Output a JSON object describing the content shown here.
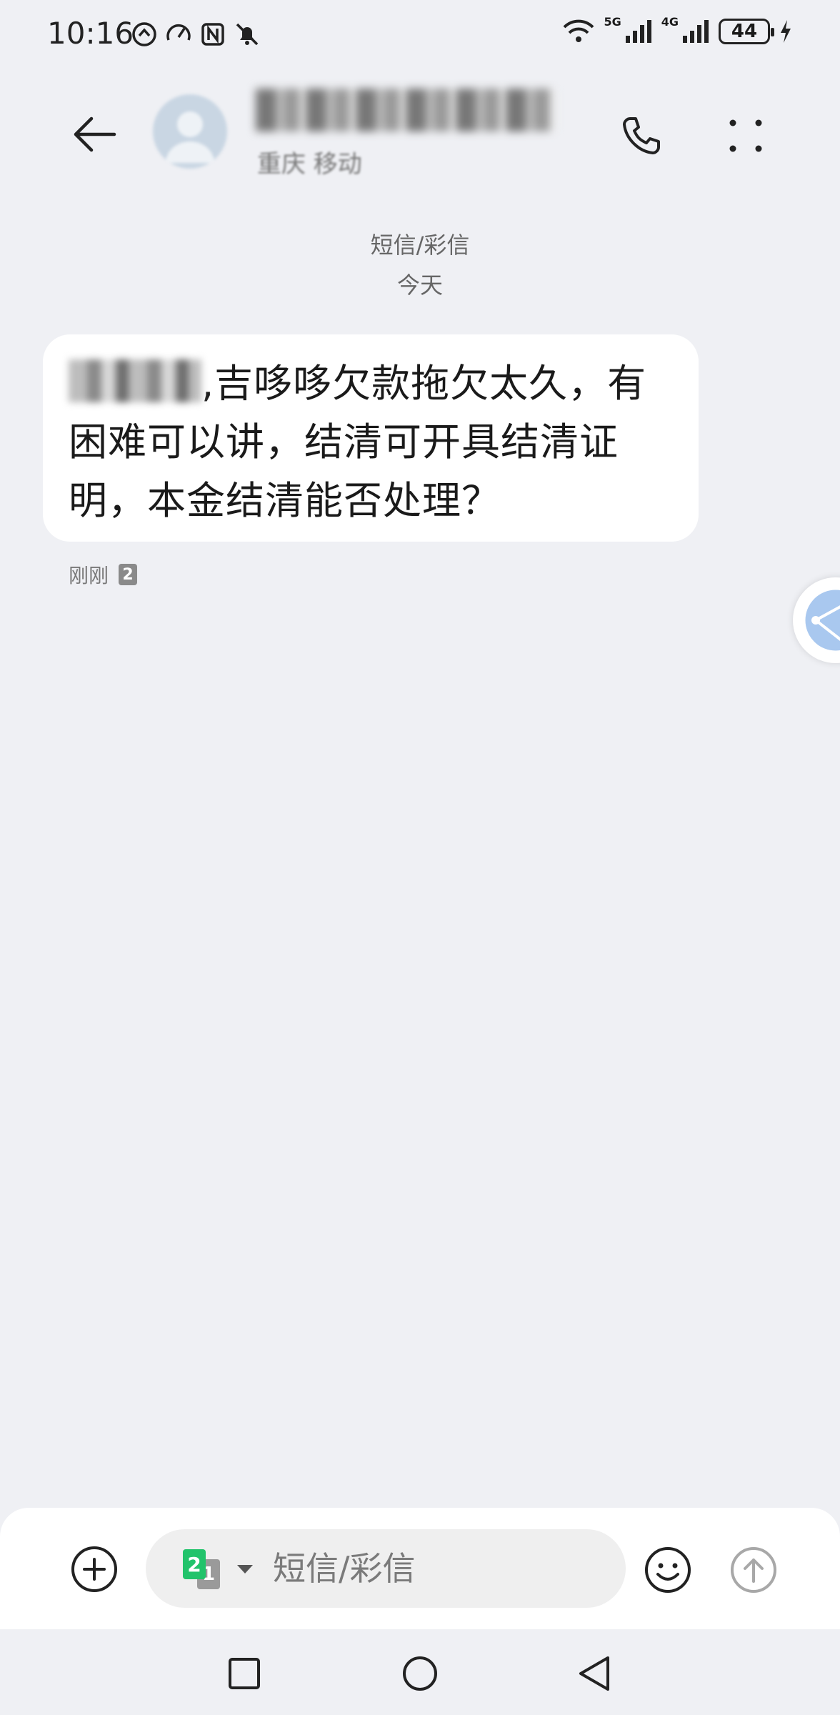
{
  "status_bar": {
    "time": "10:16",
    "left_icons": [
      "usb-debug-icon",
      "speedometer-icon",
      "nfc-icon",
      "mute-icon"
    ],
    "signal1_label": "5G",
    "signal2_label": "4G",
    "battery": "44"
  },
  "header": {
    "contact_name": "",
    "contact_sub": "重庆 移动"
  },
  "conversation": {
    "type_label": "短信/彩信",
    "day_label": "今天"
  },
  "message": {
    "text": ",吉哆哆欠款拖欠太久，有困难可以讲，结清可开具结清证明，本金结清能否处理？",
    "time": "刚刚",
    "sim": "2"
  },
  "composer": {
    "sim_primary": "2",
    "sim_secondary": "1",
    "placeholder": "短信/彩信"
  },
  "colors": {
    "background": "#eff0f4",
    "bubble": "#ffffff",
    "sim_green": "#22c36b"
  }
}
